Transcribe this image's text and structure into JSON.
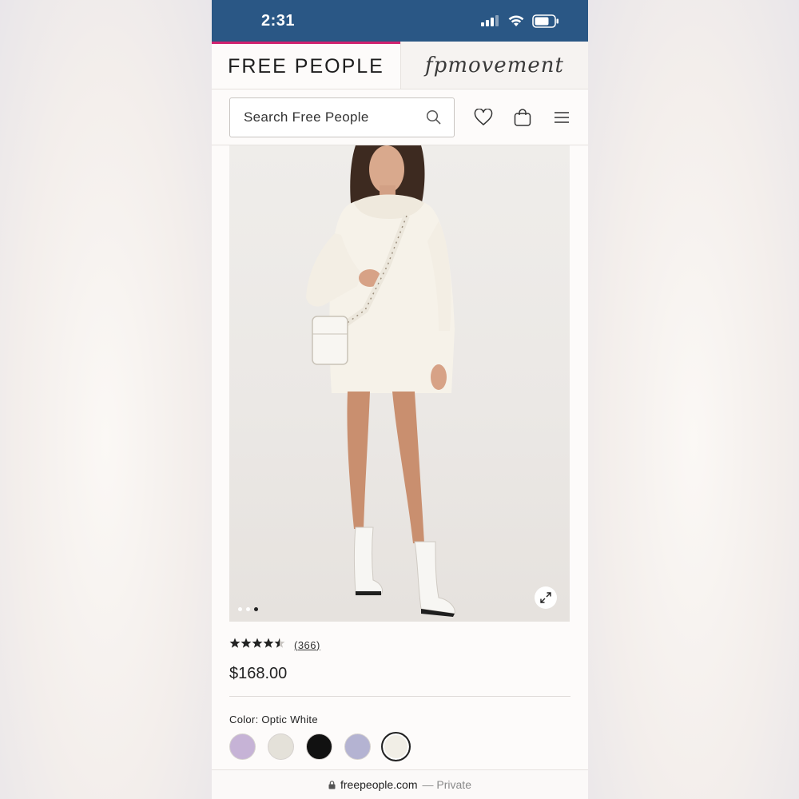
{
  "status_bar": {
    "time": "2:31"
  },
  "brand_tabs": {
    "primary": "FREE PEOPLE",
    "secondary": "fpmovement"
  },
  "header": {
    "search_placeholder": "Search Free People",
    "icons": [
      "search-icon",
      "heart-icon",
      "shopping-bag-icon",
      "menu-icon"
    ]
  },
  "product": {
    "image_alt": "Model wearing optic white turtleneck sweater dress with white boots and white crossbody bag",
    "carousel": {
      "count": 3,
      "active_index": 3
    },
    "rating": {
      "stars": 4.5,
      "stars_text": "★★★★★",
      "review_count": "(366)"
    },
    "price": "$168.00",
    "color_label": "Color: Optic White",
    "swatches": [
      {
        "name": "lilac",
        "color": "#c6b3d6"
      },
      {
        "name": "ivory",
        "color": "#e4e1d9"
      },
      {
        "name": "black",
        "color": "#111111"
      },
      {
        "name": "periwinkle",
        "color": "#b4b3d2"
      },
      {
        "name": "optic-white",
        "color": "#f1eee6",
        "selected": true
      }
    ]
  },
  "url_bar": {
    "domain": "freepeople.com",
    "private_label": "— Private"
  },
  "colors": {
    "status_bar": "#2a5785",
    "accent": "#d0226f"
  }
}
